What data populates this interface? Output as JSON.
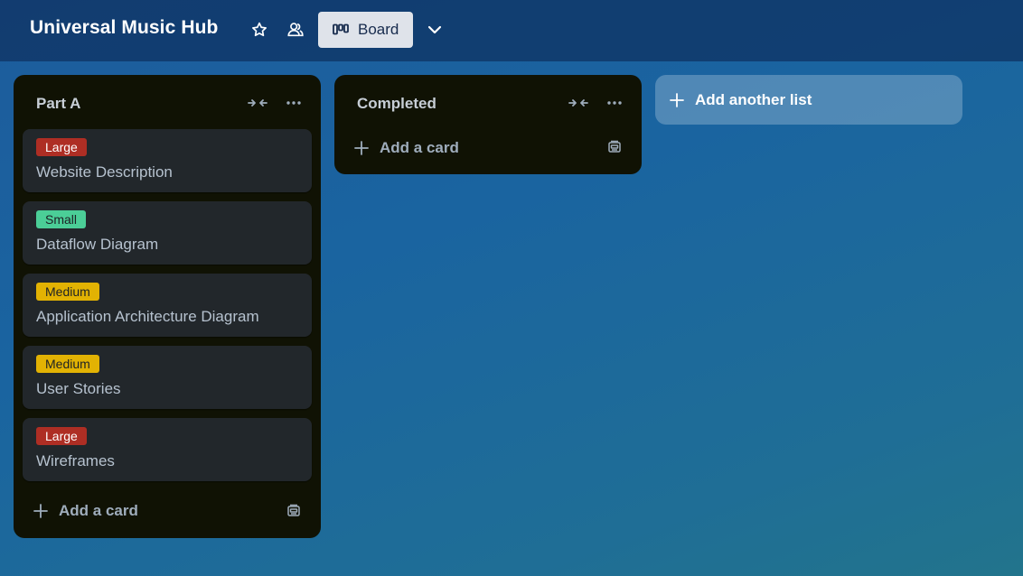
{
  "header": {
    "board_title": "Universal Music Hub",
    "star_icon": "star-icon",
    "people_icon": "workspace-visible-icon",
    "view_label": "Board",
    "view_icon": "board-icon",
    "chevron_icon": "chevron-down-icon"
  },
  "lists": [
    {
      "title": "Part A",
      "cards": [
        {
          "label": "Large",
          "label_color": "#ae2e24",
          "label_text_color": "#ffffff",
          "title": "Website Description"
        },
        {
          "label": "Small",
          "label_color": "#4bce97",
          "label_text_color": "#1d2125",
          "title": "Dataflow Diagram"
        },
        {
          "label": "Medium",
          "label_color": "#e2b203",
          "label_text_color": "#1d2125",
          "title": "Application Architecture Diagram"
        },
        {
          "label": "Medium",
          "label_color": "#e2b203",
          "label_text_color": "#1d2125",
          "title": "User Stories"
        },
        {
          "label": "Large",
          "label_color": "#ae2e24",
          "label_text_color": "#ffffff",
          "title": "Wireframes"
        }
      ],
      "add_card_label": "Add a card"
    },
    {
      "title": "Completed",
      "cards": [],
      "add_card_label": "Add a card"
    }
  ],
  "add_list_label": "Add another list",
  "colors": {
    "list_bg": "#101204",
    "card_bg": "#22272b",
    "text_muted": "#9fadbc"
  }
}
